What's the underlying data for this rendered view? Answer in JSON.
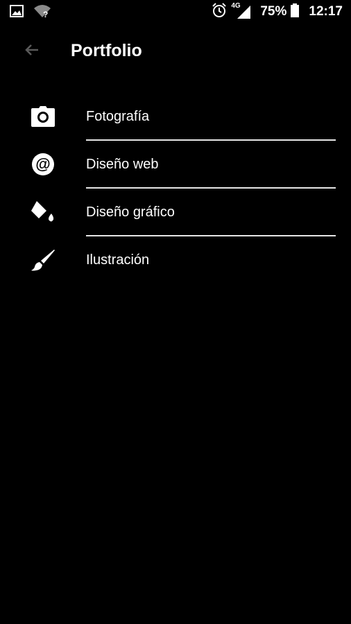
{
  "status_bar": {
    "icons_left": [
      "image-icon",
      "wifi-unknown-icon"
    ],
    "icons_right": [
      "alarm-icon",
      "signal-4g-icon",
      "battery-icon"
    ],
    "network": "4G",
    "battery": "75%",
    "time": "12:17"
  },
  "toolbar": {
    "back_icon": "arrow-back-icon",
    "title": "Portfolio"
  },
  "menu": {
    "items": [
      {
        "label": "Fotografía",
        "icon": "camera-icon"
      },
      {
        "label": "Diseño web",
        "icon": "at-sign-icon"
      },
      {
        "label": "Diseño gráfico",
        "icon": "paint-bucket-icon"
      },
      {
        "label": "Ilustración",
        "icon": "brush-icon"
      }
    ]
  },
  "colors": {
    "background": "#000000",
    "text": "#ffffff",
    "divider": "#e6e6e6",
    "back_arrow": "#5a5a5a"
  }
}
